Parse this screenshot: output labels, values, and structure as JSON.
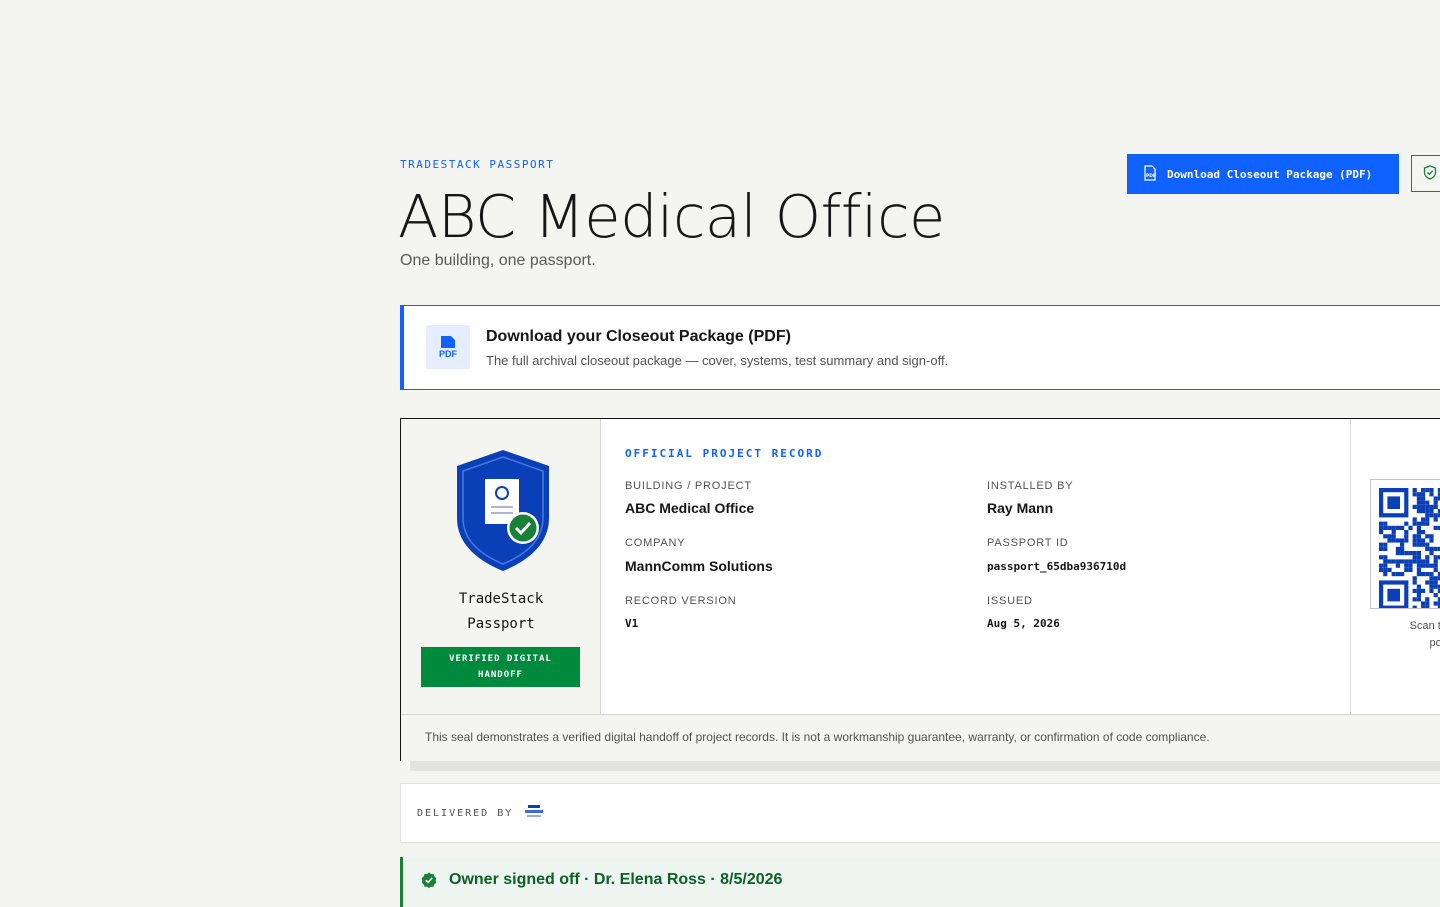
{
  "header": {
    "eyebrow": "TRADESTACK PASSPORT",
    "title": "ABC Medical Office",
    "subtitle": "One building, one passport.",
    "download_button_label": "Download Closeout Package (PDF)"
  },
  "banner": {
    "icon_label": "PDF",
    "title": "Download your Closeout Package (PDF)",
    "subtitle": "The full archival closeout package — cover, systems, test summary and sign-off."
  },
  "seal": {
    "name_line1": "TradeStack",
    "name_line2": "Passport",
    "badge_line1": "VERIFIED DIGITAL",
    "badge_line2": "HANDOFF",
    "colors": {
      "shield": "#0a3fb8",
      "check": "#198038"
    }
  },
  "record": {
    "heading": "OFFICIAL PROJECT RECORD",
    "fields": {
      "building_label": "BUILDING / PROJECT",
      "building_value": "ABC Medical Office",
      "installer_label": "INSTALLED BY",
      "installer_value": "Ray Mann",
      "company_label": "COMPANY",
      "company_value": "MannComm Solutions",
      "passport_id_label": "PASSPORT ID",
      "passport_id_value": "passport_65dba936710d",
      "version_label": "RECORD VERSION",
      "version_value": "V1",
      "issued_label": "ISSUED",
      "issued_value": "Aug 5, 2026"
    },
    "qr_caption_line1": "Scan to ope",
    "qr_caption_line2": "port",
    "disclaimer": "This seal demonstrates a verified digital handoff of project records. It is not a workmanship guarantee, warranty, or confirmation of code compliance."
  },
  "delivered": {
    "label": "DELIVERED BY"
  },
  "signoff": {
    "text": "Owner signed off · Dr. Elena Ross · 8/5/2026"
  },
  "colors": {
    "accent": "#0f62fe",
    "success": "#198038",
    "background": "#f4f4f1"
  }
}
